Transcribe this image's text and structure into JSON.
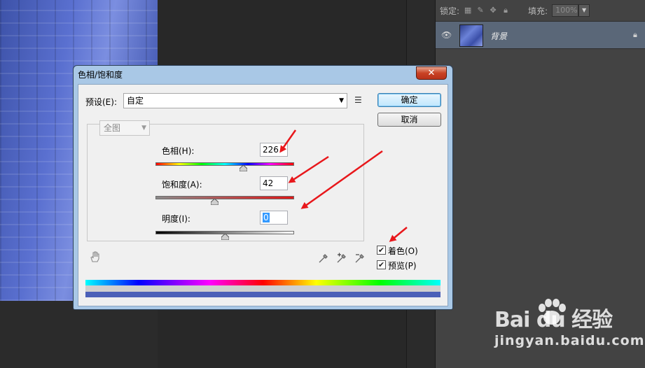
{
  "layers_panel": {
    "lock_label": "锁定:",
    "fill_label": "填充:",
    "fill_value": "100%",
    "layer_name": "背景"
  },
  "dialog": {
    "title": "色相/饱和度",
    "close_glyph": "✕",
    "preset_label": "预设(E):",
    "preset_value": "自定",
    "ok_label": "确定",
    "cancel_label": "取消",
    "channel_value": "全图",
    "hue_label": "色相(H):",
    "hue_value": "226",
    "saturation_label": "饱和度(A):",
    "saturation_value": "42",
    "lightness_label": "明度(I):",
    "lightness_value": "0",
    "colorize_label": "着色(O)",
    "colorize_checked": "✔",
    "preview_label": "预览(P)",
    "preview_checked": "✔",
    "hue_slider": {
      "value": 226,
      "min": -180,
      "max": 180
    },
    "saturation_slider": {
      "value": 42,
      "min": 0,
      "max": 100
    },
    "lightness_slider": {
      "value": 0,
      "min": -100,
      "max": 100
    }
  },
  "colors": {
    "annotation_arrow": "#e8171b",
    "dialog_frame": "#a9c8e6",
    "colorize_result": "#4b60b8"
  },
  "watermark": {
    "brand_text": "Bai  du 经验",
    "url_text": "jingyan.baidu.com"
  }
}
